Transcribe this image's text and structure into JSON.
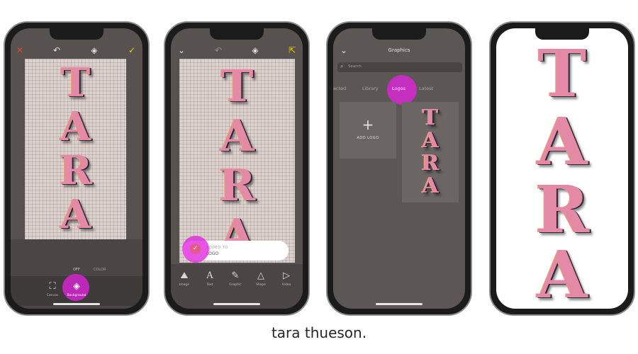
{
  "logo_letters": [
    "T",
    "A",
    "R",
    "A"
  ],
  "phone1": {
    "topbar_icons": [
      "close-icon",
      "undo-icon",
      "layers-icon",
      "check-icon"
    ],
    "options": [
      "OFF",
      "COLOR"
    ],
    "tools": [
      {
        "label": "Canvas",
        "icon": "crop-icon"
      },
      {
        "label": "Background",
        "icon": "paint-bucket-icon"
      }
    ]
  },
  "phone2": {
    "topbar_icons": [
      "chevron-down-icon",
      "undo-icon",
      "layers-icon",
      "export-icon"
    ],
    "toast": {
      "line1": "ADDED TO",
      "line2": "LOGO"
    },
    "tools": [
      {
        "label": "Image",
        "icon": "image-icon"
      },
      {
        "label": "Text",
        "icon": "text-icon"
      },
      {
        "label": "Graphic",
        "icon": "graphic-icon"
      },
      {
        "label": "Shape",
        "icon": "shape-icon"
      },
      {
        "label": "Video",
        "icon": "video-icon"
      }
    ]
  },
  "phone3": {
    "title": "Graphics",
    "search_placeholder": "Search",
    "tabs": [
      "ected",
      "Library",
      "Logos",
      "Latest"
    ],
    "active_tab": "Logos",
    "add_logo": "ADD LOGO"
  },
  "caption": "tara thueson.",
  "colors": {
    "accent": "#e224de",
    "check": "#f0d000",
    "close": "#e8443a",
    "dark_ui": "#575150"
  }
}
